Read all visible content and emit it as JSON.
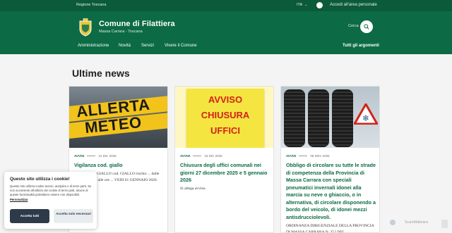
{
  "topbar": {
    "region": "Regione Toscana",
    "language": "ITA",
    "login": "Accedi all'area personale"
  },
  "header": {
    "title": "Comune di Filattiera",
    "subtitle": "Massa Carrara - Toscana",
    "search_label": "Cerca",
    "nav": [
      "Amministrazione",
      "Novità",
      "Servizi",
      "Vivere il Comune"
    ],
    "all_topics": "Tutti gli argomenti"
  },
  "section": {
    "title": "Ultime news"
  },
  "cards": [
    {
      "image_text": [
        "ALLERTA",
        "METEO"
      ],
      "category": "AVVISI",
      "date": "31 DIC 2025",
      "title": "Vigilanza cod. giallo",
      "body": "VIGILANZE-GIALLO cod. GIALLO rischio ... dalle ore 00:00 sino alle ore ... VEDI 01 GENNAIO 2026."
    },
    {
      "image_text": [
        "AVVISO",
        "CHIUSURA",
        "UFFICI"
      ],
      "category": "AVVISI",
      "date": "15 DIC 2025",
      "title": "Chiusura degli uffici comunali nei giorni 27 dicembre 2025 e 5 gennaio 2026",
      "body": "Si allega avviso."
    },
    {
      "category": "AVVISI",
      "date": "06 NOV 2025",
      "title": "Obbligo di circolare su tutte le strade di competenza della Provincia di Massa Carrara con speciali pneumatici invernali idonei alla marcia su neve o ghiaccio, o in alternativa, di circolare disponendo a bordo del veicolo, di idonei mezzi antisdrucciolevoli.",
      "body": "ORDINANZA DIRIGENZIALE DELLA PROVINCIA DI MASSA CARRARA N. 252 DEL"
    }
  ],
  "cookie": {
    "title": "Questo sito utilizza i cookie!",
    "text": "Questo sito utilizza cookie tecnici, analytics e di terze parti. Se non acconsenti all'utilizzo dei cookie di terze parti, alcune di queste funzionalità potrebbero essere non disponibili.",
    "link": "Personalizza",
    "accept": "Accetta tutti",
    "necessary": "Accetta solo necessari"
  },
  "watermark": "ScanMalware",
  "colors": {
    "primary": "#0c6b44",
    "topbar": "#0b5a3a",
    "accent_yellow": "#f2c31a",
    "alert_red": "#d3231a"
  }
}
